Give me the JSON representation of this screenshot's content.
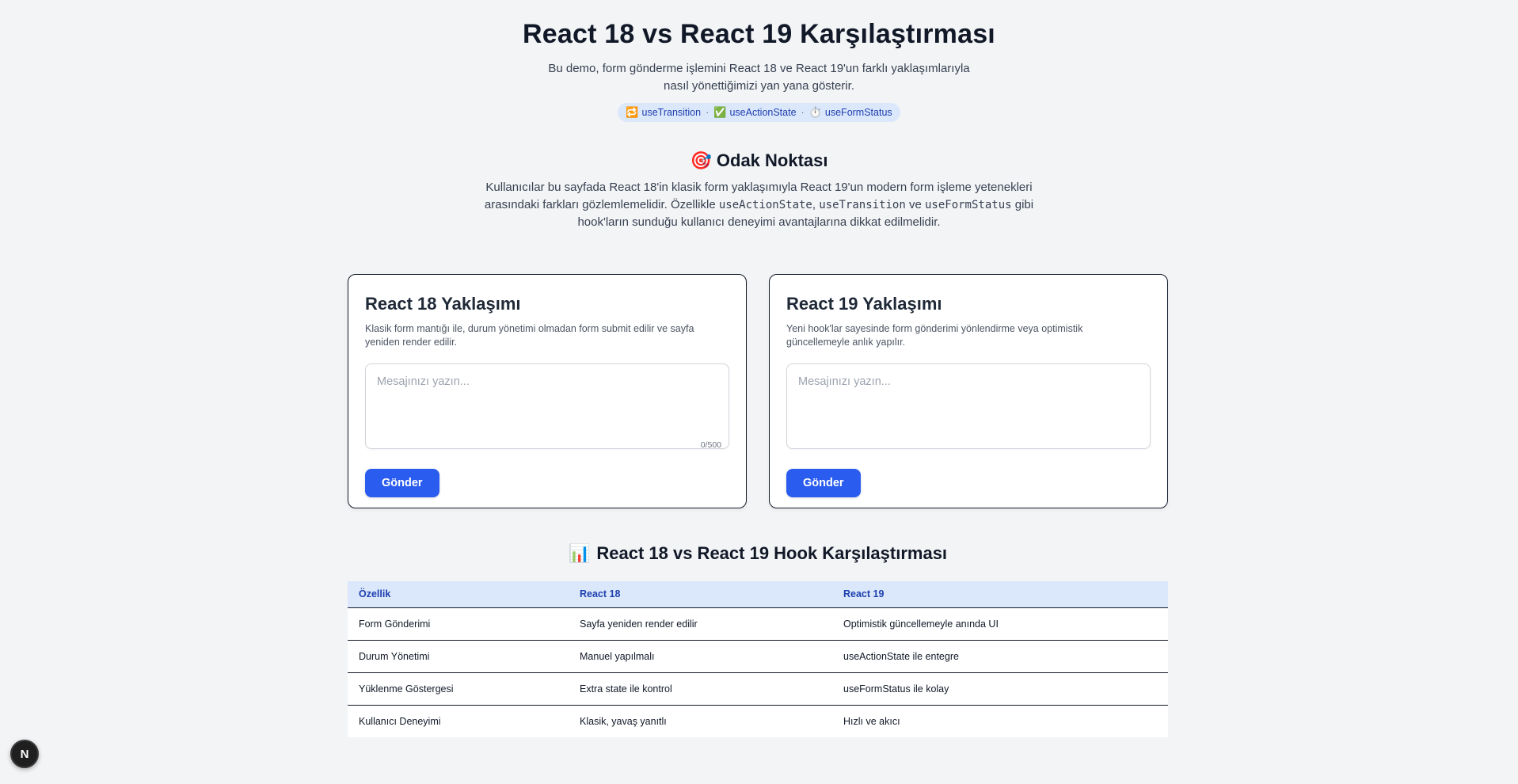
{
  "header": {
    "title": "React 18 vs React 19 Karşılaştırması",
    "subtitle": "Bu demo, form gönderme işlemini React 18 ve React 19'un farklı yaklaşımlarıyla nasıl yönettiğimizi yan yana gösterir.",
    "pills": [
      {
        "icon": "🔁",
        "label": "useTransition"
      },
      {
        "icon": "✅",
        "label": "useActionState"
      },
      {
        "icon": "⏱️",
        "label": "useFormStatus"
      }
    ],
    "pill_separator": "·"
  },
  "focus": {
    "icon": "🎯",
    "title": "Odak Noktası",
    "text_part1": "Kullanıcılar bu sayfada React 18'in klasik form yaklaşımıyla React 19'un modern form işleme yetenekleri arasındaki farkları gözlemlemelidir. Özellikle ",
    "code1": "useActionState",
    "sep1": ", ",
    "code2": "useTransition",
    "sep2": " ve ",
    "code3": "useFormStatus",
    "text_part2": " gibi hook'ların sunduğu kullanıcı deneyimi avantajlarına dikkat edilmelidir."
  },
  "cards": {
    "react18": {
      "title": "React 18 Yaklaşımı",
      "description": "Klasik form mantığı ile, durum yönetimi olmadan form submit edilir ve sayfa yeniden render edilir.",
      "placeholder": "Mesajınızı yazın...",
      "counter": "0/500",
      "button": "Gönder"
    },
    "react19": {
      "title": "React 19 Yaklaşımı",
      "description": "Yeni hook'lar sayesinde form gönderimi yönlendirme veya optimistik güncellemeyle anlık yapılır.",
      "placeholder": "Mesajınızı yazın...",
      "button": "Gönder"
    }
  },
  "comparison": {
    "icon": "📊",
    "title": "React 18 vs React 19 Hook Karşılaştırması",
    "headers": [
      "Özellik",
      "React 18",
      "React 19"
    ],
    "rows": [
      [
        "Form Gönderimi",
        "Sayfa yeniden render edilir",
        "Optimistik güncellemeyle anında UI"
      ],
      [
        "Durum Yönetimi",
        "Manuel yapılmalı",
        "useActionState ile entegre"
      ],
      [
        "Yüklenme Göstergesi",
        "Extra state ile kontrol",
        "useFormStatus ile kolay"
      ],
      [
        "Kullanıcı Deneyimi",
        "Klasik, yavaş yanıtlı",
        "Hızlı ve akıcı"
      ]
    ]
  },
  "badge": {
    "label": "N"
  }
}
